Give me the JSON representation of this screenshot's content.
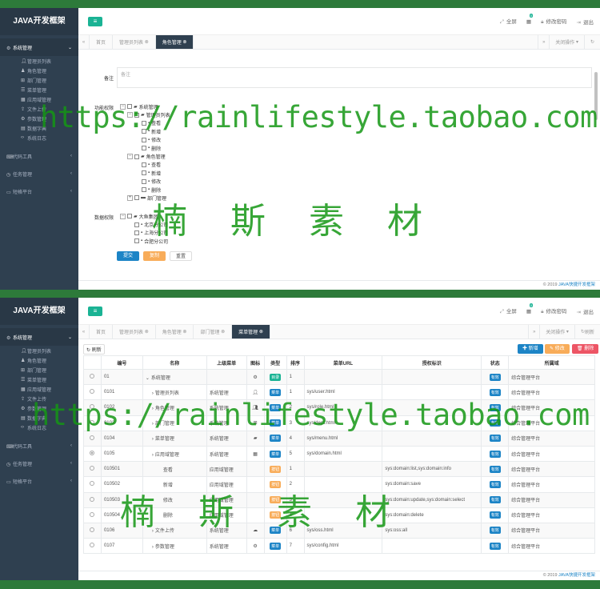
{
  "brand": "JAVA开发框架",
  "sidebar": {
    "group1": "系统管理",
    "subs": [
      "管理员列表",
      "角色管理",
      "部门管理",
      "菜单管理",
      "应用域管理",
      "文件上传",
      "参数管理",
      "数据字典",
      "系统日志"
    ],
    "group2": "代码工具",
    "group3": "任务管理",
    "group4": "短格平台"
  },
  "topbar": {
    "fullscreen": "全屏",
    "badge": "0",
    "change_password": "修改密码",
    "logout": "退出"
  },
  "tabs1": [
    "首页",
    "管理员列表",
    "角色管理"
  ],
  "tabs2": [
    "首页",
    "管理员列表",
    "角色管理",
    "部门管理",
    "菜单管理"
  ],
  "close_ops": "关闭操作",
  "refresh_short": "刷新",
  "form": {
    "remark_label": "备注",
    "remark_placeholder": "备注",
    "func_label": "功能权限",
    "data_label": "数据权限",
    "tree_func": [
      {
        "lvl": 0,
        "ex": "−",
        "icon": "folder-open",
        "text": "系统管理"
      },
      {
        "lvl": 1,
        "ex": "−",
        "icon": "folder-open",
        "text": "管理员列表"
      },
      {
        "lvl": 2,
        "ex": "",
        "icon": "file",
        "text": "查看"
      },
      {
        "lvl": 2,
        "ex": "",
        "icon": "file",
        "text": "新增"
      },
      {
        "lvl": 2,
        "ex": "",
        "icon": "file",
        "text": "修改"
      },
      {
        "lvl": 2,
        "ex": "",
        "icon": "file",
        "text": "删除"
      },
      {
        "lvl": 1,
        "ex": "−",
        "icon": "folder-open",
        "text": "角色管理"
      },
      {
        "lvl": 2,
        "ex": "",
        "icon": "file",
        "text": "查看"
      },
      {
        "lvl": 2,
        "ex": "",
        "icon": "file",
        "text": "新增"
      },
      {
        "lvl": 2,
        "ex": "",
        "icon": "file",
        "text": "修改"
      },
      {
        "lvl": 2,
        "ex": "",
        "icon": "file",
        "text": "删除"
      },
      {
        "lvl": 1,
        "ex": "+",
        "icon": "folder",
        "text": "部门管理"
      }
    ],
    "tree_data": [
      {
        "lvl": 0,
        "ex": "−",
        "icon": "folder-open",
        "text": "大鱼集团"
      },
      {
        "lvl": 1,
        "ex": "",
        "icon": "file",
        "text": "北京分公司"
      },
      {
        "lvl": 1,
        "ex": "",
        "icon": "file",
        "text": "上海分公司"
      },
      {
        "lvl": 1,
        "ex": "",
        "icon": "file",
        "text": "合肥分公司"
      }
    ],
    "btn_submit": "提交",
    "btn_reset": "复制",
    "btn_reset2": "重置"
  },
  "table": {
    "refresh": "刷新",
    "add": "新增",
    "edit": "修改",
    "del": "删除",
    "headers": [
      "",
      "编号",
      "名称",
      "上级菜单",
      "图标",
      "类型",
      "排序",
      "菜单URL",
      "授权标识",
      "状态",
      "所属域"
    ],
    "rows": [
      [
        "01",
        "系统管理",
        "",
        "gear",
        "目录",
        "1",
        "",
        "",
        "有效",
        "综合管理平台",
        0,
        false
      ],
      [
        "0101",
        "管理员列表",
        "系统管理",
        "user",
        "菜单",
        "1",
        "sys/user.html",
        "",
        "有效",
        "综合管理平台",
        1,
        false
      ],
      [
        "0102",
        "角色管理",
        "系统管理",
        "user-group",
        "菜单",
        "2",
        "sys/role.html",
        "",
        "有效",
        "综合管理平台",
        1,
        false
      ],
      [
        "0103",
        "部门管理",
        "系统管理",
        "sitemap",
        "菜单",
        "3",
        "sys/dept.html",
        "",
        "有效",
        "综合管理平台",
        1,
        false
      ],
      [
        "0104",
        "菜单管理",
        "系统管理",
        "folder",
        "菜单",
        "4",
        "sys/menu.html",
        "",
        "有效",
        "综合管理平台",
        1,
        false
      ],
      [
        "0105",
        "应用域管理",
        "系统管理",
        "grid",
        "菜单",
        "5",
        "sys/domain.html",
        "",
        "有效",
        "综合管理平台",
        1,
        true
      ],
      [
        "010501",
        "查看",
        "应用域管理",
        "",
        "按钮",
        "1",
        "",
        "sys:domain:list,sys:domain:info",
        "有效",
        "综合管理平台",
        2,
        false
      ],
      [
        "010502",
        "新增",
        "应用域管理",
        "",
        "按钮",
        "2",
        "",
        "sys:domain:save",
        "有效",
        "综合管理平台",
        2,
        false
      ],
      [
        "010503",
        "修改",
        "应用域管理",
        "",
        "按钮",
        "3",
        "",
        "sys:domain:update,sys:domain:select",
        "有效",
        "综合管理平台",
        2,
        false
      ],
      [
        "010504",
        "删除",
        "应用域管理",
        "",
        "按钮",
        "4",
        "",
        "sys:domain:delete",
        "有效",
        "综合管理平台",
        2,
        false
      ],
      [
        "0106",
        "文件上传",
        "系统管理",
        "cloud",
        "菜单",
        "6",
        "sys/oss.html",
        "sys:oss:all",
        "有效",
        "综合管理平台",
        1,
        false
      ],
      [
        "0107",
        "参数管理",
        "系统管理",
        "gears",
        "菜单",
        "7",
        "sys/config.html",
        "",
        "有效",
        "综合管理平台",
        1,
        false
      ]
    ]
  },
  "footer": {
    "copyright": "© 2019",
    "link": "JAVA快捷开发框架"
  },
  "watermark": {
    "url": "https://rainlifestyle.taobao.com",
    "cn": "楠斯素材"
  },
  "colors": {
    "sidebar": "#2f4050",
    "accent": "#1ab394",
    "blue": "#1c84c6",
    "orange": "#f8ac59",
    "red": "#ed5565",
    "frame": "#2d7a3a"
  }
}
